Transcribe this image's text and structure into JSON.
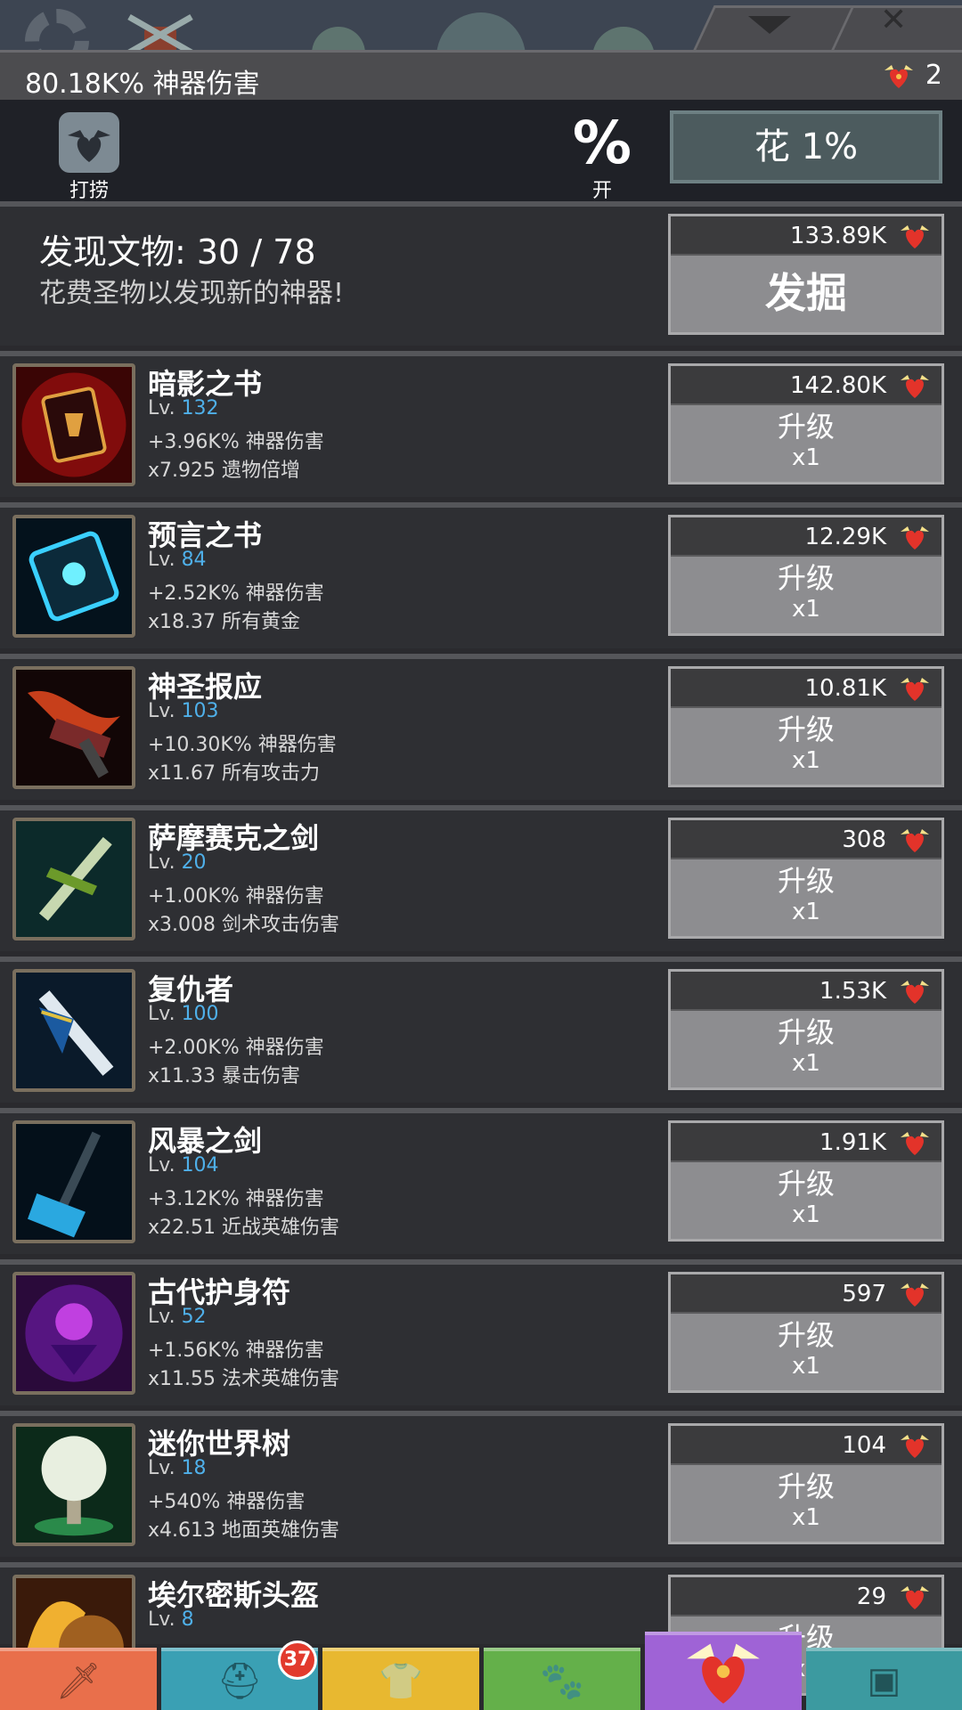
{
  "header": {
    "damage_text": "80.18K% 神器伤害",
    "relic_count": "2"
  },
  "controls": {
    "salvage_label": "打捞",
    "percent_icon": "%",
    "percent_label": "开",
    "spend_button": "花 1%"
  },
  "discover": {
    "title": "发现文物: 30 / 78",
    "subtitle": "花费圣物以发现新的神器!",
    "price": "133.89K",
    "button": "发掘"
  },
  "upgrade_label": "升级",
  "multiplier_label": "x1",
  "lv_prefix": "Lv.",
  "artifacts": [
    {
      "name": "暗影之书",
      "level": "132",
      "stat1": "+3.96K% 神器伤害",
      "stat2": "x7.925 遗物倍增",
      "price": "142.80K",
      "icon": "shadow-book-icon"
    },
    {
      "name": "预言之书",
      "level": "84",
      "stat1": "+2.52K% 神器伤害",
      "stat2": "x18.37 所有黄金",
      "price": "12.29K",
      "icon": "prophecy-book-icon"
    },
    {
      "name": "神圣报应",
      "level": "103",
      "stat1": "+10.30K% 神器伤害",
      "stat2": "x11.67 所有攻击力",
      "price": "10.81K",
      "icon": "divine-retribution-icon"
    },
    {
      "name": "萨摩赛克之剑",
      "level": "20",
      "stat1": "+1.00K% 神器伤害",
      "stat2": "x3.008 剑术攻击伤害",
      "price": "308",
      "icon": "samosek-sword-icon"
    },
    {
      "name": "复仇者",
      "level": "100",
      "stat1": "+2.00K% 神器伤害",
      "stat2": "x11.33 暴击伤害",
      "price": "1.53K",
      "icon": "avenger-sword-icon"
    },
    {
      "name": "风暴之剑",
      "level": "104",
      "stat1": "+3.12K% 神器伤害",
      "stat2": "x22.51 近战英雄伤害",
      "price": "1.91K",
      "icon": "storm-sword-icon"
    },
    {
      "name": "古代护身符",
      "level": "52",
      "stat1": "+1.56K% 神器伤害",
      "stat2": "x11.55 法术英雄伤害",
      "price": "597",
      "icon": "amulet-icon"
    },
    {
      "name": "迷你世界树",
      "level": "18",
      "stat1": "+540% 神器伤害",
      "stat2": "x4.613 地面英雄伤害",
      "price": "104",
      "icon": "world-tree-icon"
    },
    {
      "name": "埃尔密斯头盔",
      "level": "8",
      "stat1": "",
      "stat2": "",
      "price": "29",
      "icon": "hermes-helmet-icon"
    }
  ],
  "tabs": [
    {
      "name": "sword-tab",
      "icon": "sword-icon"
    },
    {
      "name": "heroes-tab",
      "icon": "viking-helmet-icon",
      "badge": "37"
    },
    {
      "name": "equipment-tab",
      "icon": "shirt-icon"
    },
    {
      "name": "pets-tab",
      "icon": "pet-icon"
    },
    {
      "name": "artifacts-tab",
      "icon": "winged-heart-icon",
      "active": true
    },
    {
      "name": "shop-tab",
      "icon": "chest-icon"
    }
  ],
  "colors": {
    "level_blue": "#4fb0ea",
    "badge_red": "#e23a2d",
    "active_tab": "#9f63d6"
  }
}
